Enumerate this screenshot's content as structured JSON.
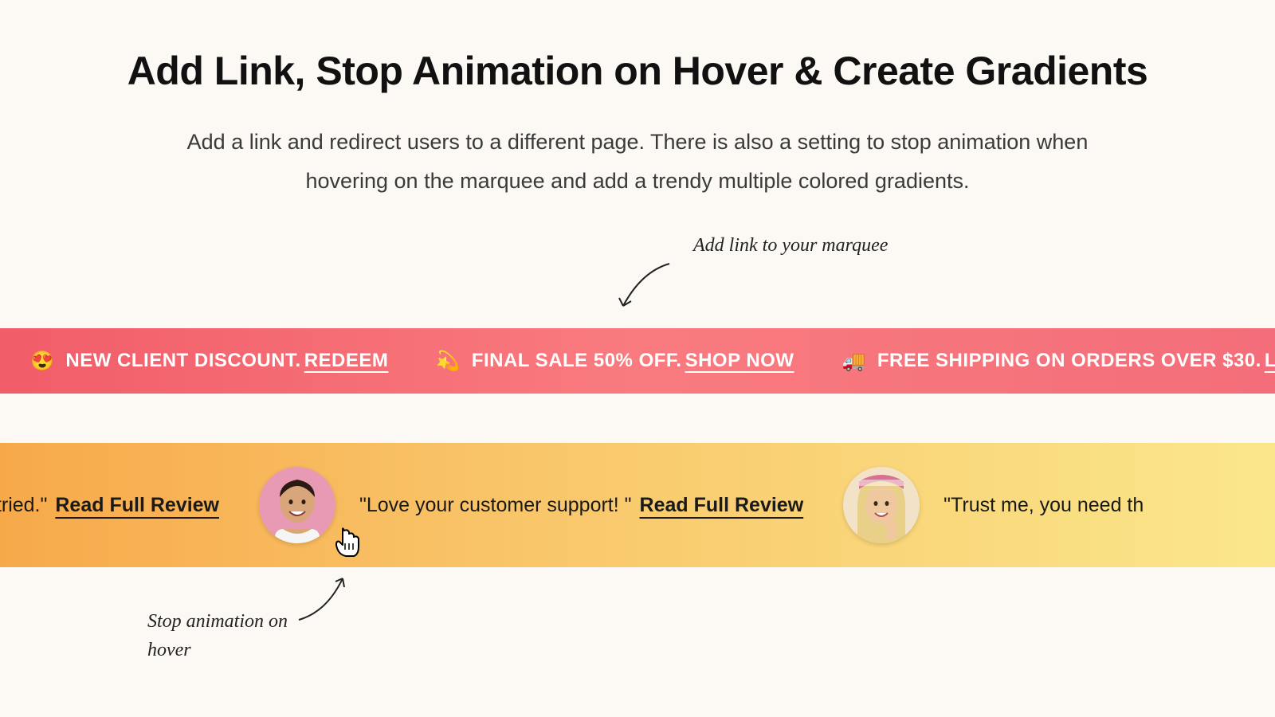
{
  "hero": {
    "title": "Add Link, Stop Animation on Hover & Create Gradients",
    "subtitle": "Add a link and redirect users to a different page. There is also a setting to stop animation when hovering on the marquee and add a trendy multiple colored gradients."
  },
  "annotations": {
    "top": "Add link to your marquee",
    "bottom": "Stop animation on hover"
  },
  "marquee1": {
    "items": [
      {
        "emoji": "😍",
        "text": "NEW CLIENT DISCOUNT.",
        "link": "REDEEM"
      },
      {
        "emoji": "💫",
        "text": "FINAL SALE 50% OFF.",
        "link": "SHOP NOW"
      },
      {
        "emoji": "🚚",
        "text": "FREE SHIPPING ON ORDERS OVER $30.",
        "link": "LEARN MORE"
      }
    ]
  },
  "marquee2": {
    "items": [
      {
        "quote": "ral deodorant I've ever tried.\"",
        "link": "Read Full Review"
      },
      {
        "quote": "\"Love your customer support! \"",
        "link": "Read Full Review"
      },
      {
        "quote": "\"Trust me, you need th",
        "link": ""
      }
    ]
  }
}
